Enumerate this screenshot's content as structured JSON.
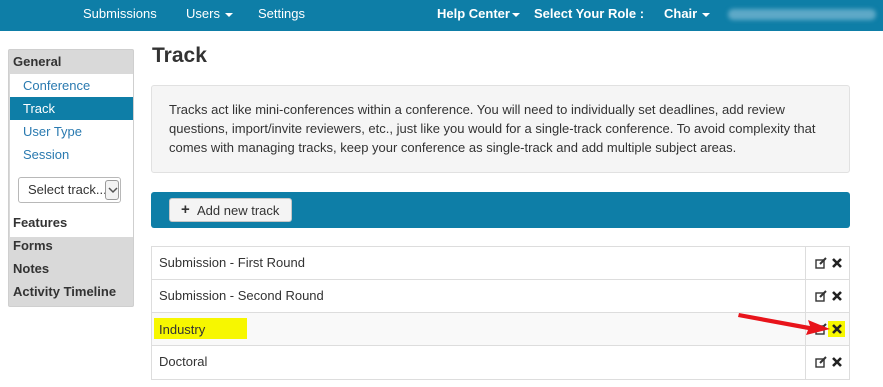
{
  "nav": {
    "submissions": "Submissions",
    "users": "Users",
    "settings": "Settings",
    "help_center": "Help Center",
    "select_role_label": "Select Your Role :",
    "role": "Chair"
  },
  "sidebar": {
    "general": "General",
    "items": [
      {
        "label": "Conference"
      },
      {
        "label": "Track"
      },
      {
        "label": "User Type"
      },
      {
        "label": "Session"
      }
    ],
    "select_track": "Select track...",
    "features": "Features",
    "forms": "Forms",
    "notes": "Notes",
    "activity_timeline": "Activity Timeline"
  },
  "main": {
    "title": "Track",
    "info": "Tracks act like mini-conferences within a conference. You will need to individually set deadlines, add review questions, import/invite reviewers, etc., just like you would for a single-track conference. To avoid complexity that comes with managing tracks, keep your conference as single-track and add multiple subject areas.",
    "add_button": "Add new track",
    "tracks": [
      {
        "name": "Submission - First Round"
      },
      {
        "name": "Submission - Second Round"
      },
      {
        "name": "Industry"
      },
      {
        "name": "Doctoral"
      }
    ]
  },
  "colors": {
    "primary": "#0e7ea7",
    "highlight": "#f7f700",
    "annotation_arrow": "#e8141b"
  },
  "icons": [
    "caret-down-icon",
    "plus-icon",
    "edit-icon",
    "delete-icon",
    "chevron-down-icon",
    "red-arrow-icon"
  ]
}
